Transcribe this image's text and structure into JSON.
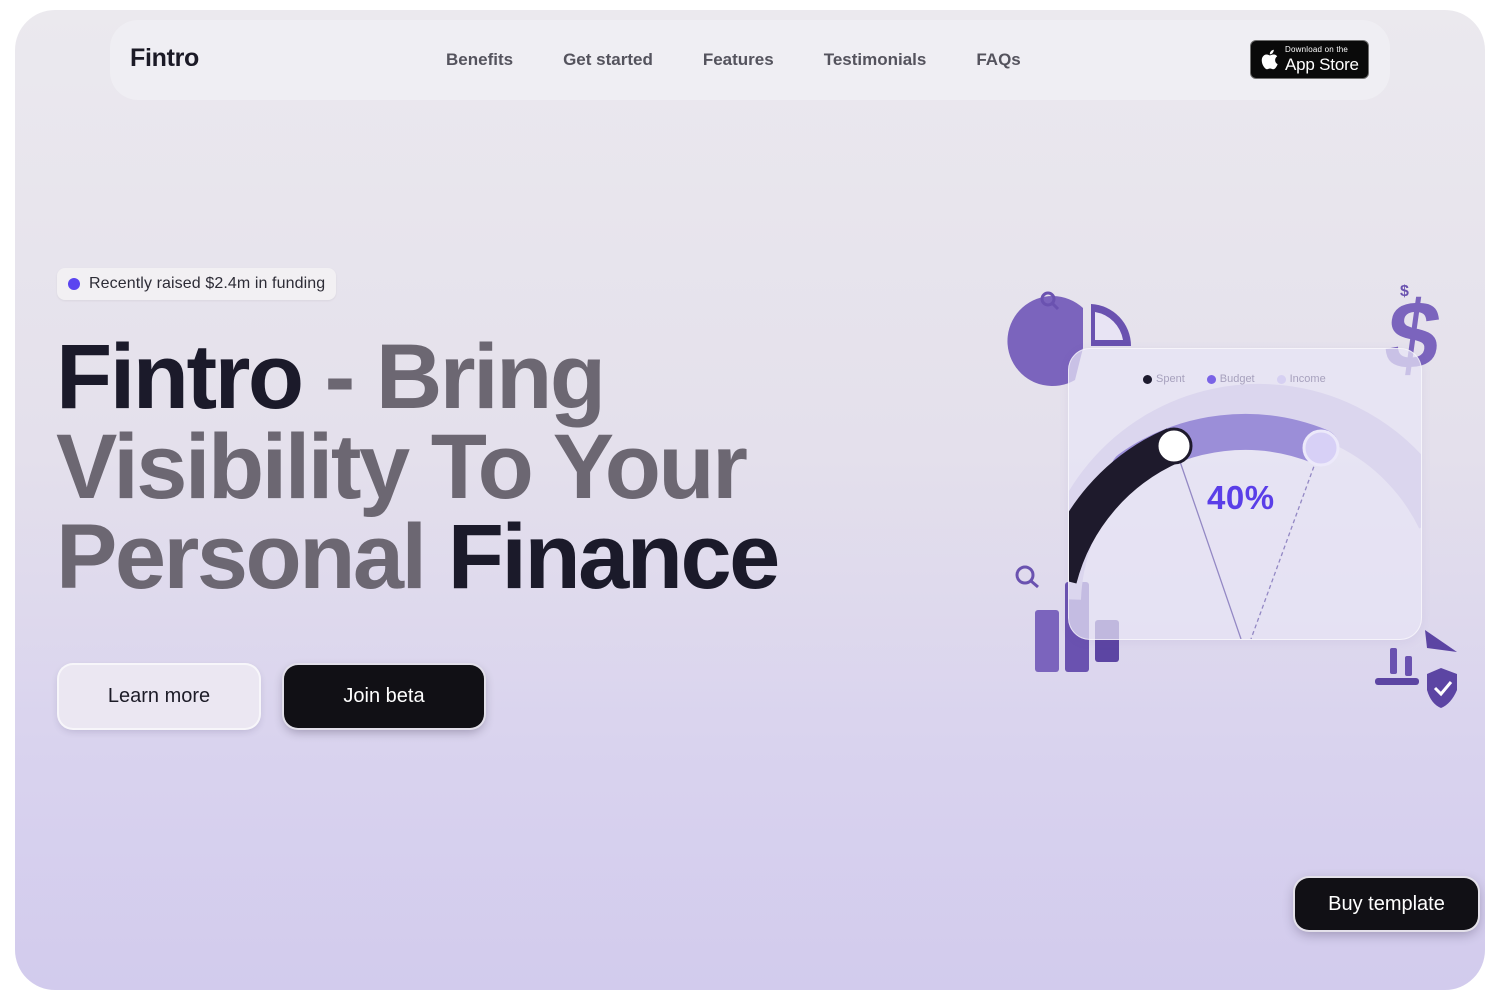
{
  "nav": {
    "brand": "Fintro",
    "links": [
      "Benefits",
      "Get started",
      "Features",
      "Testimonials",
      "FAQs"
    ],
    "appstore_small": "Download on the",
    "appstore_big": "App Store"
  },
  "hero": {
    "badge": "Recently raised $2.4m in funding",
    "headline_part1": "Fintro",
    "headline_part2": " - Bring Visibility To Your Personal ",
    "headline_part3": "Finance",
    "learn_more": "Learn more",
    "join_beta": "Join beta"
  },
  "card": {
    "legend": [
      {
        "label": "Spent",
        "color": "#1d1a2e"
      },
      {
        "label": "Budget",
        "color": "#7a63e6"
      },
      {
        "label": "Income",
        "color": "#d6d0f2"
      }
    ],
    "percent": "40%"
  },
  "buy_template": "Buy template",
  "colors": {
    "accent": "#5b45f0",
    "dark": "#111015",
    "purple": "#7a63e6"
  }
}
